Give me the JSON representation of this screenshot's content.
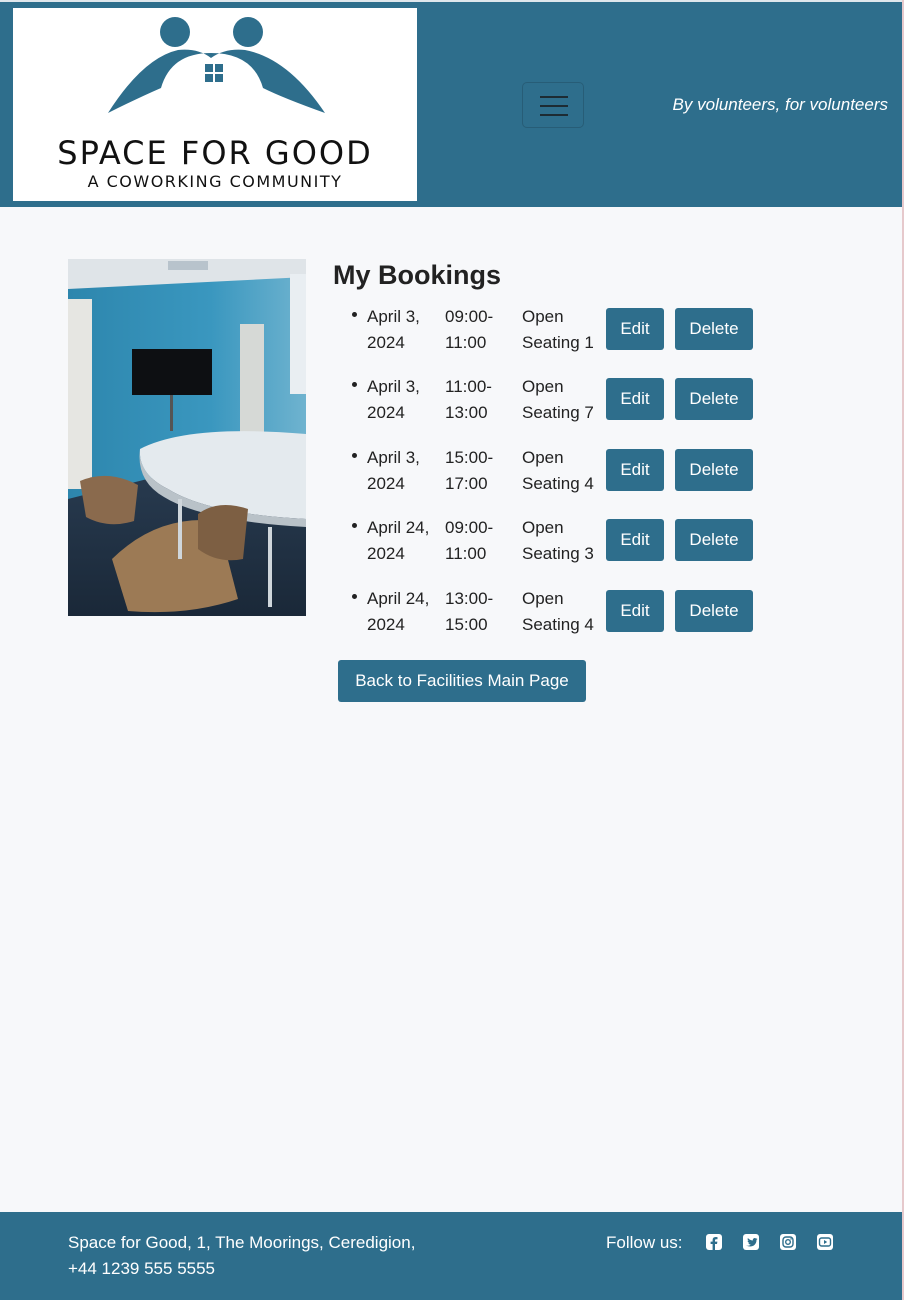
{
  "header": {
    "logo_title": "SPACE FOR GOOD",
    "logo_subtitle": "A COWORKING COMMUNITY",
    "tagline": "By volunteers, for volunteers",
    "menu_icon": "hamburger-icon"
  },
  "main": {
    "title": "My Bookings",
    "bookings": [
      {
        "date": "April 3, 2024",
        "time": "09:00-11:00",
        "space": "Open Seating 1",
        "edit_label": "Edit",
        "delete_label": "Delete"
      },
      {
        "date": "April 3, 2024",
        "time": "11:00-13:00",
        "space": "Open Seating 7",
        "edit_label": "Edit",
        "delete_label": "Delete"
      },
      {
        "date": "April 3, 2024",
        "time": "15:00-17:00",
        "space": "Open Seating 4",
        "edit_label": "Edit",
        "delete_label": "Delete"
      },
      {
        "date": "April 24, 2024",
        "time": "09:00-11:00",
        "space": "Open Seating 3",
        "edit_label": "Edit",
        "delete_label": "Delete"
      },
      {
        "date": "April 24, 2024",
        "time": "13:00-15:00",
        "space": "Open Seating 4",
        "edit_label": "Edit",
        "delete_label": "Delete"
      }
    ],
    "back_button": "Back to Facilities Main Page"
  },
  "footer": {
    "address_line1": "Space for Good, 1, The Moorings, Ceredigion,",
    "address_line2": "+44 1239 555 5555",
    "follow_label": "Follow us:",
    "social_icons": [
      "facebook-icon",
      "twitter-icon",
      "instagram-icon",
      "youtube-icon"
    ]
  },
  "colors": {
    "brand": "#2e6e8c",
    "background": "#f7f8fa",
    "text": "#222222"
  }
}
